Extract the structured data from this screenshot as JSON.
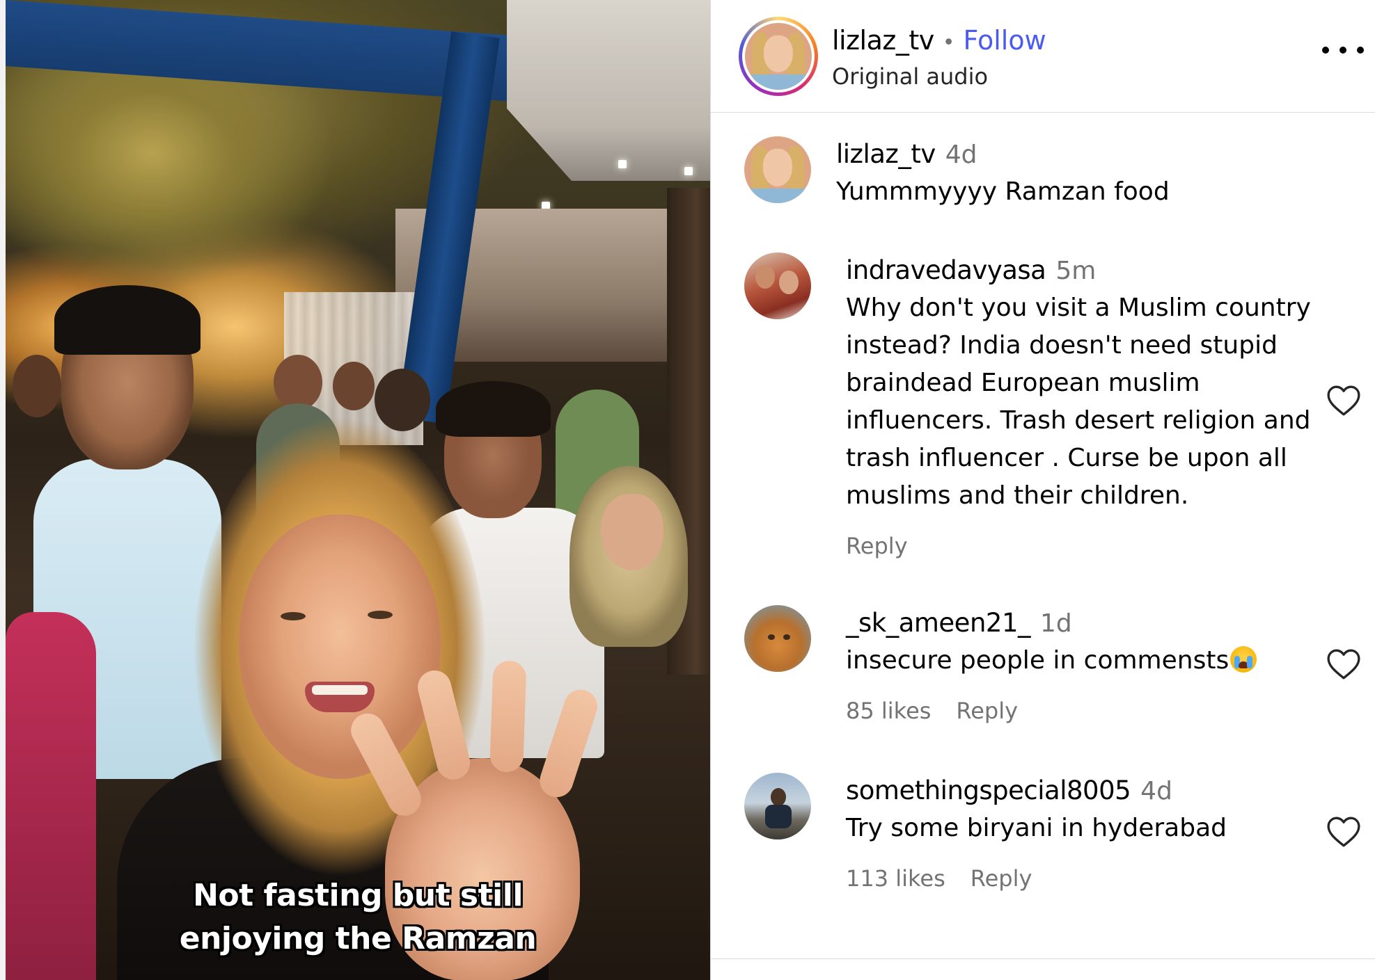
{
  "video": {
    "caption_line1": "Not fasting but still",
    "caption_line2": "enjoying the Ramzan"
  },
  "header": {
    "username": "lizlaz_tv",
    "separator": "•",
    "follow_label": "Follow",
    "audio_label": "Original audio",
    "more_icon": "more-horizontal-icon"
  },
  "post_caption": {
    "username": "lizlaz_tv",
    "time": "4d",
    "text": "Yummmyyyy Ramzan food"
  },
  "comments": [
    {
      "username": "indravedavyasa",
      "time": "5m",
      "text": "Why don't you visit a Muslim country instead? India doesn't need stupid braindead European muslim influencers. Trash desert religion and trash influencer . Curse be upon all muslims and their children.",
      "likes": "",
      "reply_label": "Reply"
    },
    {
      "username": "_sk_ameen21_",
      "time": "1d",
      "text": "insecure people in commensts",
      "emoji": "loudly-crying-face-icon",
      "likes": "85 likes",
      "reply_label": "Reply"
    },
    {
      "username": "somethingspecial8005",
      "time": "4d",
      "text": "Try some biryani in hyderabad",
      "likes": "113 likes",
      "reply_label": "Reply"
    }
  ],
  "colors": {
    "follow": "#4a5bf0",
    "secondary_text": "#737373",
    "divider": "#dbdbdb"
  }
}
